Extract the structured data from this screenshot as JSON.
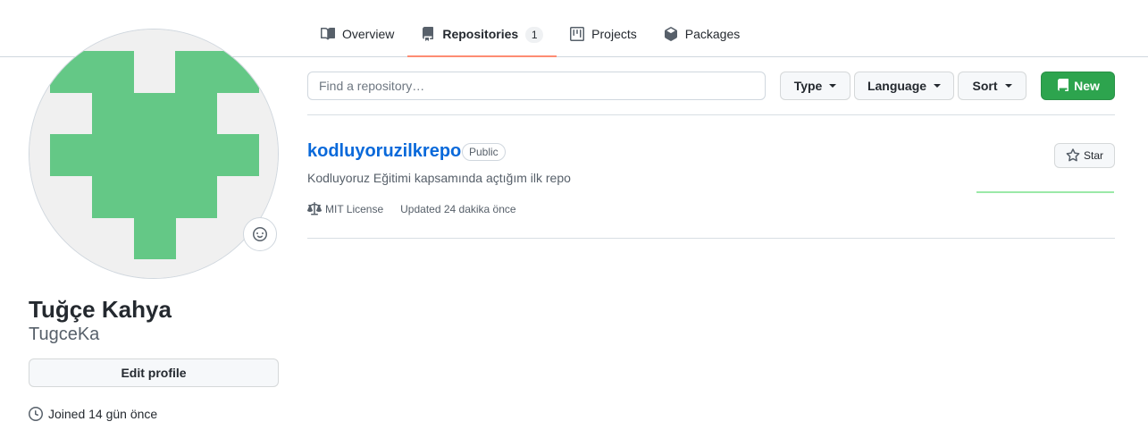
{
  "nav": {
    "tabs": [
      {
        "label": "Overview",
        "icon": "book-icon"
      },
      {
        "label": "Repositories",
        "icon": "repo-icon",
        "count": "1",
        "selected": true
      },
      {
        "label": "Projects",
        "icon": "project-icon"
      },
      {
        "label": "Packages",
        "icon": "package-icon"
      }
    ]
  },
  "profile": {
    "fullname": "Tuğçe Kahya",
    "username": "TugceKa",
    "edit_label": "Edit profile",
    "joined": "Joined 14 gün önce",
    "avatar_color": "#64c886",
    "avatar_bg": "#f0f0f0"
  },
  "toolbar": {
    "search_placeholder": "Find a repository…",
    "type_label": "Type",
    "language_label": "Language",
    "sort_label": "Sort",
    "new_label": "New",
    "new_color": "#2da44e"
  },
  "repo": {
    "name": "kodluyoruzilkrepo",
    "visibility": "Public",
    "description": "Kodluyoruz Eğitimi kapsamında açtığım ilk repo",
    "license": "MIT License",
    "updated": "Updated 24 dakika önce",
    "star_label": "Star",
    "link_color": "#0969da"
  }
}
